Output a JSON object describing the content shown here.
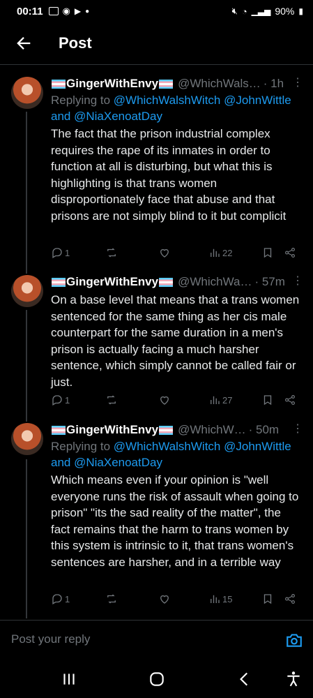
{
  "status": {
    "time": "00:11",
    "battery": "90%"
  },
  "header": {
    "title": "Post"
  },
  "tweets": [
    {
      "name": "GingerWithEnvy",
      "handle": "@WhichWals…",
      "time": "· 1h",
      "replying_prefix": "Replying to ",
      "mention1": "@WhichWalshWitch",
      "mention2": "@JohnWittle",
      "and": "and ",
      "mention3": "@NiaXenoatDay",
      "text": "The fact that the prison industrial complex requires the rape of its inmates in order to function at all is disturbing, but what this is highlighting is that trans women disproportionately face that abuse and that prisons are not simply blind to it but complicit",
      "replies": "1",
      "views": "22"
    },
    {
      "name": "GingerWithEnvy",
      "handle": "@WhichWa…",
      "time": "· 57m",
      "text": "On a base level that means that a trans women sentenced for the same thing as her cis male counterpart for the same duration in a men's prison is actually facing a much harsher sentence, which simply cannot be called fair or just.",
      "replies": "1",
      "views": "27"
    },
    {
      "name": "GingerWithEnvy",
      "handle": "@WhichW…",
      "time": "· 50m",
      "replying_prefix": "Replying to ",
      "mention1": "@WhichWalshWitch",
      "mention2": "@JohnWittle",
      "and": "and ",
      "mention3": "@NiaXenoatDay",
      "text": "Which means even if your opinion is \"well everyone runs the risk of assault when going to prison\" \"its the sad reality of the matter\", the fact remains that the harm to trans women by this system is intrinsic to it, that trans women's sentences are harsher, and in a terrible way",
      "replies": "1",
      "views": "15"
    }
  ],
  "reply_bar": {
    "placeholder": "Post your reply"
  },
  "colors": {
    "accent": "#1d9bf0",
    "muted": "#71767b",
    "background": "#000000"
  }
}
